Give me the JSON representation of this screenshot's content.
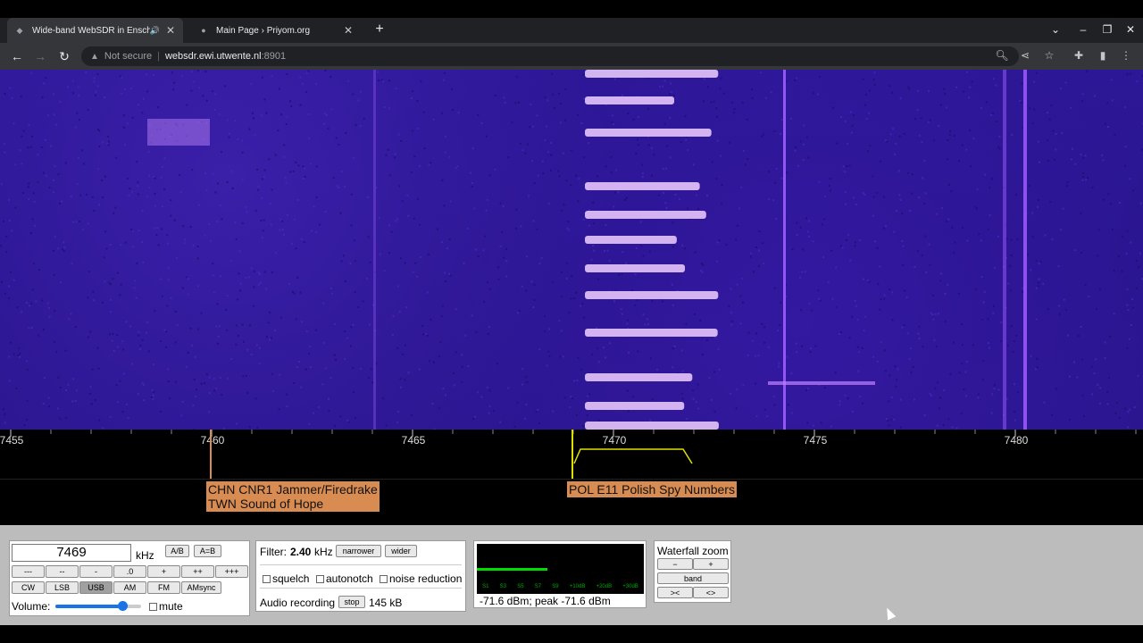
{
  "browser": {
    "tabs": [
      {
        "title": "Wide-band WebSDR in Ensch",
        "favicon": "websdr-icon",
        "audio": true
      },
      {
        "title": "Main Page › Priyom.org",
        "favicon": "priyom-icon",
        "audio": false
      }
    ],
    "address": {
      "security": "Not secure",
      "host": "websdr.ewi.utwente.nl",
      "port": ":8901"
    }
  },
  "scale": {
    "ticks": [
      "7455",
      "7460",
      "7465",
      "7470",
      "7475",
      "7480"
    ]
  },
  "stations": [
    {
      "lines": [
        "CHN CNR1 Jammer/Firedrake",
        "TWN Sound of Hope"
      ]
    },
    {
      "lines": [
        "POL E11 Polish Spy Numbers"
      ]
    }
  ],
  "tuning": {
    "freq": "7469",
    "unit": "kHz",
    "ab": "A/B",
    "aeqb": "A=B",
    "steps": [
      "---",
      "--",
      "-",
      ".0",
      "+",
      "++",
      "+++"
    ],
    "modes": [
      "CW",
      "LSB",
      "USB",
      "AM",
      "FM",
      "AMsync"
    ],
    "selected_mode": "USB",
    "volume_label": "Volume:",
    "volume_level": 0.78,
    "mute_label": "mute"
  },
  "filter": {
    "label": "Filter:",
    "value": "2.40",
    "unit": "kHz",
    "narrower": "narrower",
    "wider": "wider",
    "squelch": "squelch",
    "autonotch": "autonotch",
    "noise_reduction": "noise reduction",
    "recording_label": "Audio recording",
    "stop": "stop",
    "size": "145 kB"
  },
  "smeter": {
    "scale": [
      "S1",
      "S3",
      "S5",
      "S7",
      "S9",
      "+10dB",
      "+20dB",
      "+30dB"
    ],
    "reading": "-71.6 dBm; peak  -71.6 dBm",
    "level": 0.42
  },
  "zoom": {
    "title": "Waterfall zoom",
    "minus": "−",
    "plus": "+",
    "band": "band",
    "narrow": ">< ",
    "wide": "<>"
  },
  "colors": {
    "waterfall_bg": "#2b168f",
    "station_label": "#d98c52",
    "passband": "#e0e000",
    "smeter_bar": "#00dd00"
  }
}
